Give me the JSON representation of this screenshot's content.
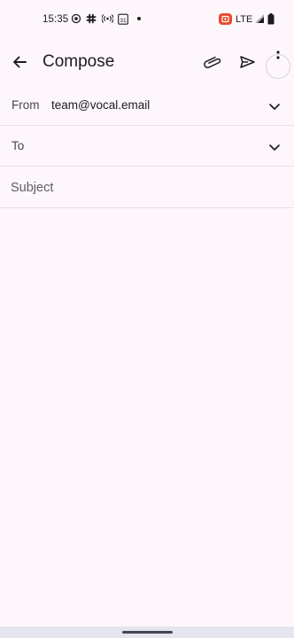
{
  "status_bar": {
    "time": "15:35",
    "network": "LTE",
    "calendar_day": "31",
    "icons": [
      "camera-status-icon",
      "slack-icon",
      "hotspot-icon",
      "calendar-icon",
      "dot-icon",
      "screen-record-icon",
      "signal-icon",
      "battery-icon"
    ],
    "record_color": "#e8492c"
  },
  "app_bar": {
    "title": "Compose",
    "actions": [
      "back-arrow-icon",
      "attach-icon",
      "send-icon",
      "more-vert-icon"
    ]
  },
  "compose": {
    "from_label": "From",
    "from_value": "team@vocal.email",
    "to_label": "To",
    "subject_placeholder": "Subject",
    "subject_value": "",
    "body_value": ""
  },
  "colors": {
    "background": "#fdf7fb",
    "divider": "#e6e1e8",
    "nav_bar": "#e6e5ee"
  }
}
